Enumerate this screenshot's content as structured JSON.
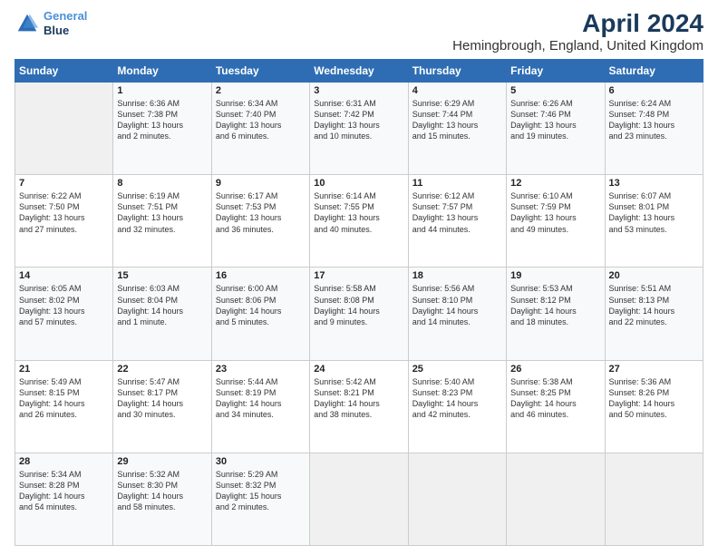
{
  "header": {
    "logo_line1": "General",
    "logo_line2": "Blue",
    "main_title": "April 2024",
    "subtitle": "Hemingbrough, England, United Kingdom"
  },
  "days_of_week": [
    "Sunday",
    "Monday",
    "Tuesday",
    "Wednesday",
    "Thursday",
    "Friday",
    "Saturday"
  ],
  "weeks": [
    [
      {
        "day": "",
        "content": ""
      },
      {
        "day": "1",
        "content": "Sunrise: 6:36 AM\nSunset: 7:38 PM\nDaylight: 13 hours\nand 2 minutes."
      },
      {
        "day": "2",
        "content": "Sunrise: 6:34 AM\nSunset: 7:40 PM\nDaylight: 13 hours\nand 6 minutes."
      },
      {
        "day": "3",
        "content": "Sunrise: 6:31 AM\nSunset: 7:42 PM\nDaylight: 13 hours\nand 10 minutes."
      },
      {
        "day": "4",
        "content": "Sunrise: 6:29 AM\nSunset: 7:44 PM\nDaylight: 13 hours\nand 15 minutes."
      },
      {
        "day": "5",
        "content": "Sunrise: 6:26 AM\nSunset: 7:46 PM\nDaylight: 13 hours\nand 19 minutes."
      },
      {
        "day": "6",
        "content": "Sunrise: 6:24 AM\nSunset: 7:48 PM\nDaylight: 13 hours\nand 23 minutes."
      }
    ],
    [
      {
        "day": "7",
        "content": "Sunrise: 6:22 AM\nSunset: 7:50 PM\nDaylight: 13 hours\nand 27 minutes."
      },
      {
        "day": "8",
        "content": "Sunrise: 6:19 AM\nSunset: 7:51 PM\nDaylight: 13 hours\nand 32 minutes."
      },
      {
        "day": "9",
        "content": "Sunrise: 6:17 AM\nSunset: 7:53 PM\nDaylight: 13 hours\nand 36 minutes."
      },
      {
        "day": "10",
        "content": "Sunrise: 6:14 AM\nSunset: 7:55 PM\nDaylight: 13 hours\nand 40 minutes."
      },
      {
        "day": "11",
        "content": "Sunrise: 6:12 AM\nSunset: 7:57 PM\nDaylight: 13 hours\nand 44 minutes."
      },
      {
        "day": "12",
        "content": "Sunrise: 6:10 AM\nSunset: 7:59 PM\nDaylight: 13 hours\nand 49 minutes."
      },
      {
        "day": "13",
        "content": "Sunrise: 6:07 AM\nSunset: 8:01 PM\nDaylight: 13 hours\nand 53 minutes."
      }
    ],
    [
      {
        "day": "14",
        "content": "Sunrise: 6:05 AM\nSunset: 8:02 PM\nDaylight: 13 hours\nand 57 minutes."
      },
      {
        "day": "15",
        "content": "Sunrise: 6:03 AM\nSunset: 8:04 PM\nDaylight: 14 hours\nand 1 minute."
      },
      {
        "day": "16",
        "content": "Sunrise: 6:00 AM\nSunset: 8:06 PM\nDaylight: 14 hours\nand 5 minutes."
      },
      {
        "day": "17",
        "content": "Sunrise: 5:58 AM\nSunset: 8:08 PM\nDaylight: 14 hours\nand 9 minutes."
      },
      {
        "day": "18",
        "content": "Sunrise: 5:56 AM\nSunset: 8:10 PM\nDaylight: 14 hours\nand 14 minutes."
      },
      {
        "day": "19",
        "content": "Sunrise: 5:53 AM\nSunset: 8:12 PM\nDaylight: 14 hours\nand 18 minutes."
      },
      {
        "day": "20",
        "content": "Sunrise: 5:51 AM\nSunset: 8:13 PM\nDaylight: 14 hours\nand 22 minutes."
      }
    ],
    [
      {
        "day": "21",
        "content": "Sunrise: 5:49 AM\nSunset: 8:15 PM\nDaylight: 14 hours\nand 26 minutes."
      },
      {
        "day": "22",
        "content": "Sunrise: 5:47 AM\nSunset: 8:17 PM\nDaylight: 14 hours\nand 30 minutes."
      },
      {
        "day": "23",
        "content": "Sunrise: 5:44 AM\nSunset: 8:19 PM\nDaylight: 14 hours\nand 34 minutes."
      },
      {
        "day": "24",
        "content": "Sunrise: 5:42 AM\nSunset: 8:21 PM\nDaylight: 14 hours\nand 38 minutes."
      },
      {
        "day": "25",
        "content": "Sunrise: 5:40 AM\nSunset: 8:23 PM\nDaylight: 14 hours\nand 42 minutes."
      },
      {
        "day": "26",
        "content": "Sunrise: 5:38 AM\nSunset: 8:25 PM\nDaylight: 14 hours\nand 46 minutes."
      },
      {
        "day": "27",
        "content": "Sunrise: 5:36 AM\nSunset: 8:26 PM\nDaylight: 14 hours\nand 50 minutes."
      }
    ],
    [
      {
        "day": "28",
        "content": "Sunrise: 5:34 AM\nSunset: 8:28 PM\nDaylight: 14 hours\nand 54 minutes."
      },
      {
        "day": "29",
        "content": "Sunrise: 5:32 AM\nSunset: 8:30 PM\nDaylight: 14 hours\nand 58 minutes."
      },
      {
        "day": "30",
        "content": "Sunrise: 5:29 AM\nSunset: 8:32 PM\nDaylight: 15 hours\nand 2 minutes."
      },
      {
        "day": "",
        "content": ""
      },
      {
        "day": "",
        "content": ""
      },
      {
        "day": "",
        "content": ""
      },
      {
        "day": "",
        "content": ""
      }
    ]
  ]
}
